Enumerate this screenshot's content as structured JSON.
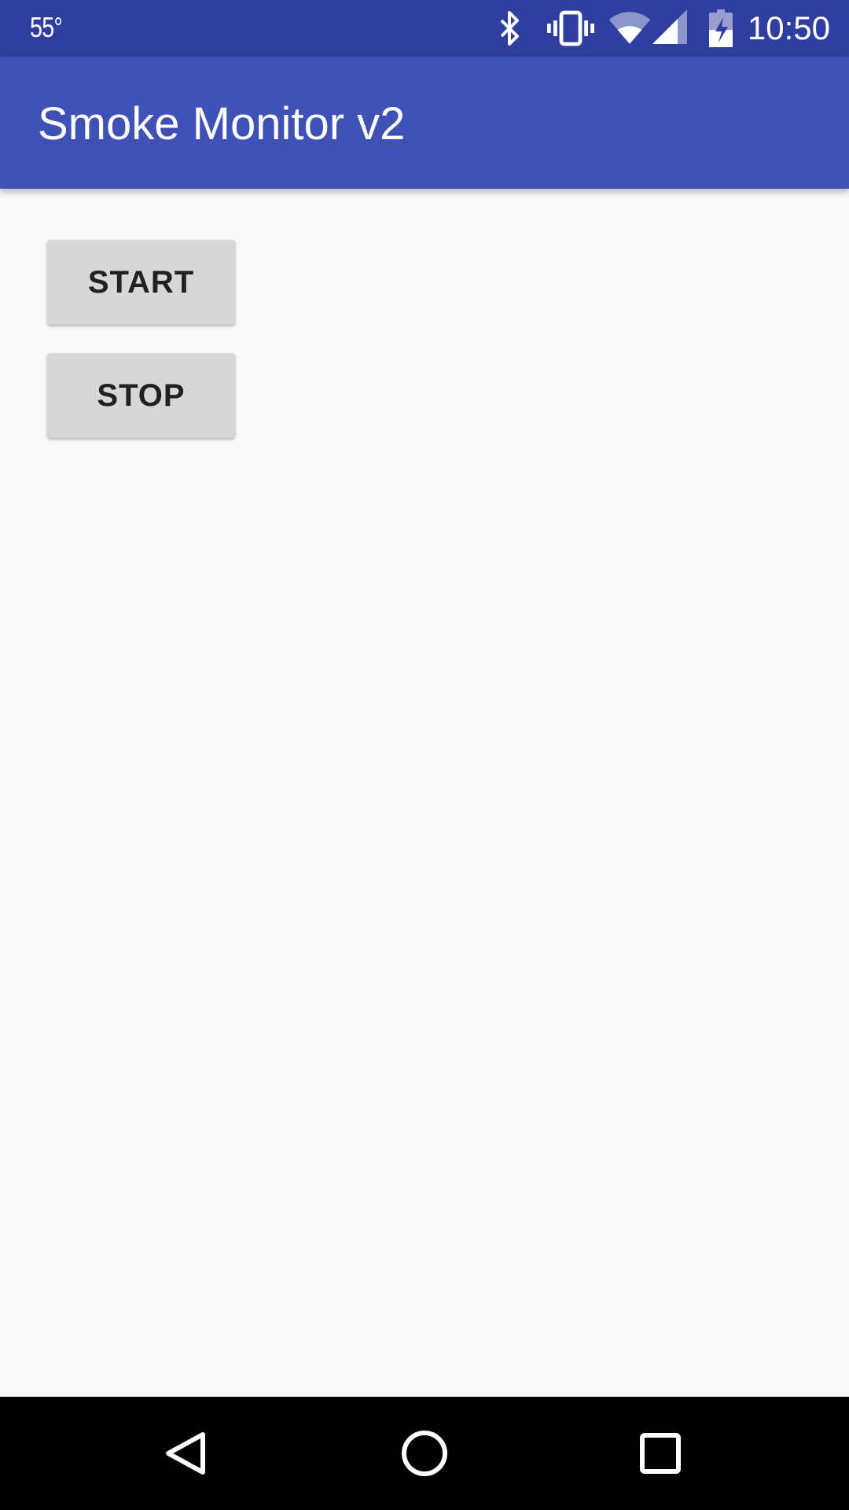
{
  "status_bar": {
    "temperature": "55°",
    "time": "10:50",
    "icons": [
      "bluetooth-icon",
      "vibrate-icon",
      "wifi-icon",
      "cell-signal-icon",
      "battery-charging-icon"
    ]
  },
  "app_bar": {
    "title": "Smoke Monitor v2",
    "color": "#3f51b5"
  },
  "buttons": {
    "start_label": "START",
    "stop_label": "STOP"
  },
  "nav_bar": {
    "icons": [
      "back-icon",
      "home-icon",
      "recents-icon"
    ]
  },
  "colors": {
    "status_bar": "#303f9f",
    "primary": "#3f51b5",
    "background": "#fafafa",
    "button": "#d6d7d7"
  }
}
